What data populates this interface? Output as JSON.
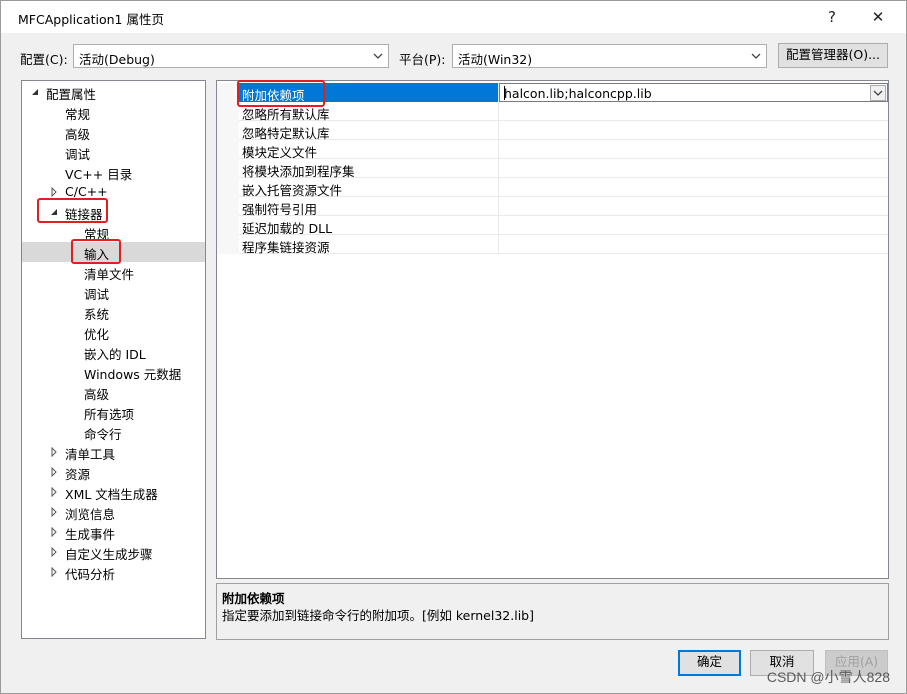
{
  "window": {
    "title": "MFCApplication1 属性页",
    "help_glyph": "?",
    "close_glyph": "✕"
  },
  "config_bar": {
    "config_label": "配置(C):",
    "config_value": "活动(Debug)",
    "platform_label": "平台(P):",
    "platform_value": "活动(Win32)",
    "manager_button": "配置管理器(O)..."
  },
  "tree": {
    "items": [
      {
        "label": "配置属性",
        "expander": "expanded"
      },
      {
        "label": "常规",
        "expander": "none"
      },
      {
        "label": "高级",
        "expander": "none"
      },
      {
        "label": "调试",
        "expander": "none"
      },
      {
        "label": "VC++ 目录",
        "expander": "none"
      },
      {
        "label": "C/C++",
        "expander": "collapsed"
      },
      {
        "label": "链接器",
        "expander": "expanded"
      },
      {
        "label": "常规",
        "expander": "none"
      },
      {
        "label": "输入",
        "expander": "none"
      },
      {
        "label": "清单文件",
        "expander": "none"
      },
      {
        "label": "调试",
        "expander": "none"
      },
      {
        "label": "系统",
        "expander": "none"
      },
      {
        "label": "优化",
        "expander": "none"
      },
      {
        "label": "嵌入的 IDL",
        "expander": "none"
      },
      {
        "label": "Windows 元数据",
        "expander": "none"
      },
      {
        "label": "高级",
        "expander": "none"
      },
      {
        "label": "所有选项",
        "expander": "none"
      },
      {
        "label": "命令行",
        "expander": "none"
      },
      {
        "label": "清单工具",
        "expander": "collapsed"
      },
      {
        "label": "资源",
        "expander": "collapsed"
      },
      {
        "label": "XML 文档生成器",
        "expander": "collapsed"
      },
      {
        "label": "浏览信息",
        "expander": "collapsed"
      },
      {
        "label": "生成事件",
        "expander": "collapsed"
      },
      {
        "label": "自定义生成步骤",
        "expander": "collapsed"
      },
      {
        "label": "代码分析",
        "expander": "collapsed"
      }
    ]
  },
  "properties": {
    "rows": [
      {
        "name": "附加依赖项",
        "value": "halcon.lib;halconcpp.lib"
      },
      {
        "name": "忽略所有默认库",
        "value": ""
      },
      {
        "name": "忽略特定默认库",
        "value": ""
      },
      {
        "name": "模块定义文件",
        "value": ""
      },
      {
        "name": "将模块添加到程序集",
        "value": ""
      },
      {
        "name": "嵌入托管资源文件",
        "value": ""
      },
      {
        "name": "强制符号引用",
        "value": ""
      },
      {
        "name": "延迟加载的 DLL",
        "value": ""
      },
      {
        "name": "程序集链接资源",
        "value": ""
      }
    ]
  },
  "description": {
    "title": "附加依赖项",
    "text": "指定要添加到链接命令行的附加项。[例如 kernel32.lib]"
  },
  "footer": {
    "ok": "确定",
    "cancel": "取消",
    "apply": "应用(A)"
  },
  "watermark": "CSDN @小雪人828",
  "colors": {
    "selection": "#0078d7",
    "highlight_box": "#e02020"
  }
}
